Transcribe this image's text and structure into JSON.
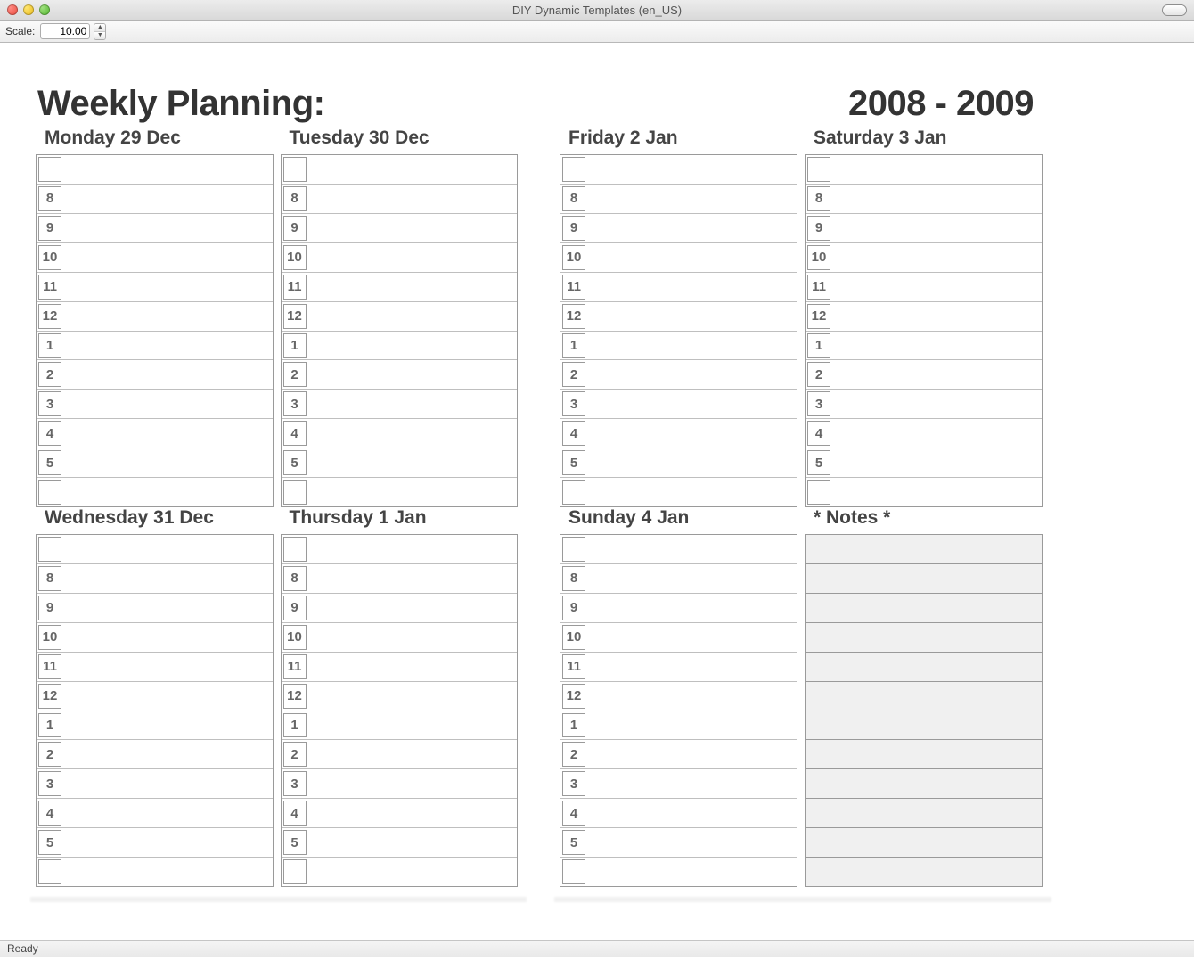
{
  "window": {
    "title": "DIY Dynamic Templates (en_US)"
  },
  "toolbar": {
    "scale_label": "Scale:",
    "scale_value": "10.00"
  },
  "planner": {
    "title": "Weekly Planning:",
    "years": "2008 - 2009",
    "notes_label": "* Notes *",
    "hours": [
      "",
      "8",
      "9",
      "10",
      "11",
      "12",
      "1",
      "2",
      "3",
      "4",
      "5",
      ""
    ],
    "days": [
      {
        "label": "Monday 29 Dec"
      },
      {
        "label": "Tuesday 30 Dec"
      },
      {
        "label": "Wednesday 31 Dec"
      },
      {
        "label": "Thursday 1 Jan"
      },
      {
        "label": "Friday 2 Jan"
      },
      {
        "label": "Saturday 3 Jan"
      },
      {
        "label": "Sunday 4 Jan"
      }
    ]
  },
  "status": {
    "text": "Ready"
  }
}
